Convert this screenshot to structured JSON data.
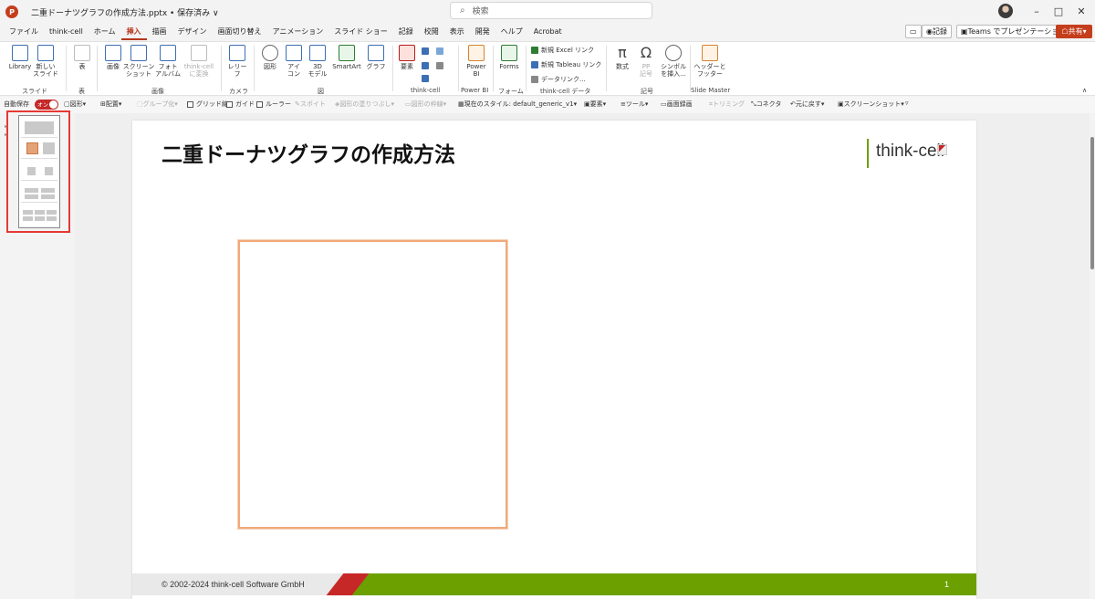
{
  "window": {
    "doc_title": "二重ドーナツグラフの作成方法.pptx • 保存済み ∨",
    "search_placeholder": "検索"
  },
  "menu": {
    "tabs": [
      "ファイル",
      "think-cell",
      "ホーム",
      "挿入",
      "描画",
      "デザイン",
      "画面切り替え",
      "アニメーション",
      "スライド ショー",
      "記録",
      "校閲",
      "表示",
      "開発",
      "ヘルプ",
      "Acrobat"
    ],
    "active_tab": "挿入",
    "record_label": "記録",
    "teams_label": "Teams でプレゼンテーション",
    "share_label": "共有"
  },
  "ribbon": {
    "buttons": {
      "library": "Library",
      "new_slide": "新しい\nスライド",
      "table": "表",
      "image": "画像",
      "screenshot": "スクリーン\nショット",
      "photo_album": "フォト\nアルバム",
      "thinkcell_convert": "think-cell\nに変換",
      "cameo": "レリー\nフ",
      "shapes": "図形",
      "icons": "アイ\nコン",
      "models3d": "3D\nモデル",
      "smartart": "SmartArt",
      "chart": "グラフ",
      "elements": "要素",
      "powerbi": "Power\nBI",
      "forms": "Forms",
      "equation": "数式",
      "pp_symbol": "PP\n記号",
      "symbol_insert": "シンボル\nを挿入...",
      "header_footer": "ヘッダーと\nフッター"
    },
    "groups": {
      "slides": "スライド",
      "table": "表",
      "images": "画像",
      "camera": "カメラ",
      "illustrations": "図",
      "thinkcell": "think-cell",
      "powerbi": "Power BI",
      "forms": "フォーム",
      "tc_data": "think-cell データ",
      "symbols": "記号",
      "slide_master": "Slide Master"
    },
    "tc_data_links": [
      "新規 Excel リンク",
      "新規 Tableau リンク",
      "データリンク..."
    ]
  },
  "toolbar": {
    "autosave": "自動保存",
    "toggle_state": "オン",
    "items": [
      "図形",
      "配置",
      "グループ化",
      "グリッド線",
      "ガイド",
      "ルーラー",
      "スポイト",
      "図形の塗りつぶし",
      "図形の枠線",
      "現在のスタイル: default_generic_v1",
      "要素",
      "ツール",
      "画面録画",
      "トリミング",
      "コネクタ",
      "元に戻す",
      "スクリーンショット"
    ]
  },
  "slide": {
    "title": "二重ドーナツグラフの作成方法",
    "logo_text": "think-cell",
    "footer_copyright": "© 2002-2024 think-cell Software GmbH",
    "page_number": "1"
  },
  "colors": {
    "accent": "#c43e1c",
    "footer_green": "#6ba000",
    "footer_red": "#c62828",
    "placeholder_border": "#f0a97a"
  }
}
